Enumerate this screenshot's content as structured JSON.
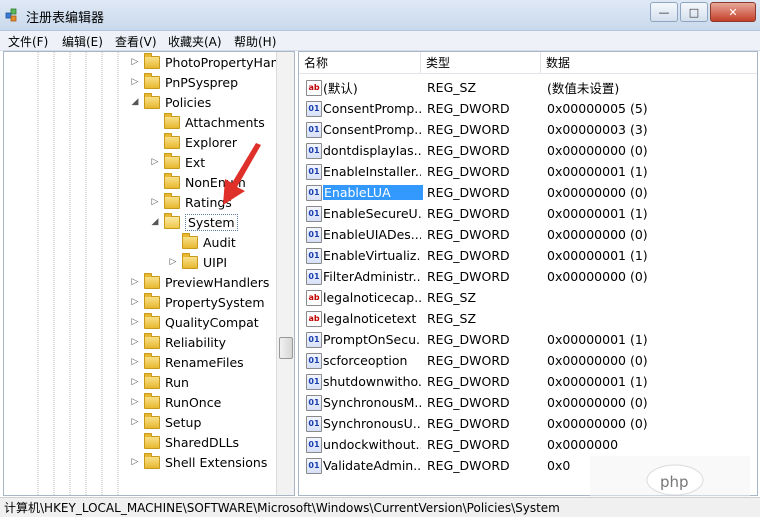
{
  "window": {
    "title": "注册表编辑器",
    "min": "—",
    "max": "□",
    "close": "✕"
  },
  "menu": [
    "文件(F)",
    "编辑(E)",
    "查看(V)",
    "收藏夹(A)",
    "帮助(H)"
  ],
  "tree": [
    {
      "label": "PhotoPropertyHand",
      "expander": "▷"
    },
    {
      "label": "PnPSysprep",
      "expander": "▷"
    },
    {
      "label": "Policies",
      "expander": "◢"
    },
    {
      "label": "Attachments",
      "expander": ""
    },
    {
      "label": "Explorer",
      "expander": ""
    },
    {
      "label": "Ext",
      "expander": "▷"
    },
    {
      "label": "NonEnum",
      "expander": ""
    },
    {
      "label": "Ratings",
      "expander": "▷"
    },
    {
      "label": "System",
      "expander": "◢"
    },
    {
      "label": "Audit",
      "expander": ""
    },
    {
      "label": "UIPI",
      "expander": "▷"
    },
    {
      "label": "PreviewHandlers",
      "expander": "▷"
    },
    {
      "label": "PropertySystem",
      "expander": "▷"
    },
    {
      "label": "QualityCompat",
      "expander": "▷"
    },
    {
      "label": "Reliability",
      "expander": "▷"
    },
    {
      "label": "RenameFiles",
      "expander": "▷"
    },
    {
      "label": "Run",
      "expander": "▷"
    },
    {
      "label": "RunOnce",
      "expander": "▷"
    },
    {
      "label": "Setup",
      "expander": "▷"
    },
    {
      "label": "SharedDLLs",
      "expander": ""
    },
    {
      "label": "Shell Extensions",
      "expander": "▷"
    }
  ],
  "columns": {
    "name": "名称",
    "type": "类型",
    "data": "数据"
  },
  "values": [
    {
      "icon": "ab",
      "name": "(默认)",
      "type": "REG_SZ",
      "data": "(数值未设置)"
    },
    {
      "icon": "01",
      "name": "ConsentPromp...",
      "type": "REG_DWORD",
      "data": "0x00000005 (5)"
    },
    {
      "icon": "01",
      "name": "ConsentPromp...",
      "type": "REG_DWORD",
      "data": "0x00000003 (3)"
    },
    {
      "icon": "01",
      "name": "dontdisplayIas...",
      "type": "REG_DWORD",
      "data": "0x00000000 (0)"
    },
    {
      "icon": "01",
      "name": "EnableInstaller...",
      "type": "REG_DWORD",
      "data": "0x00000001 (1)"
    },
    {
      "icon": "01",
      "name": "EnableLUA",
      "type": "REG_DWORD",
      "data": "0x00000000 (0)"
    },
    {
      "icon": "01",
      "name": "EnableSecureU...",
      "type": "REG_DWORD",
      "data": "0x00000001 (1)"
    },
    {
      "icon": "01",
      "name": "EnableUIADes...",
      "type": "REG_DWORD",
      "data": "0x00000000 (0)"
    },
    {
      "icon": "01",
      "name": "EnableVirtualiz...",
      "type": "REG_DWORD",
      "data": "0x00000001 (1)"
    },
    {
      "icon": "01",
      "name": "FilterAdministr...",
      "type": "REG_DWORD",
      "data": "0x00000000 (0)"
    },
    {
      "icon": "ab",
      "name": "legalnoticecap...",
      "type": "REG_SZ",
      "data": ""
    },
    {
      "icon": "ab",
      "name": "legalnoticetext",
      "type": "REG_SZ",
      "data": ""
    },
    {
      "icon": "01",
      "name": "PromptOnSecu...",
      "type": "REG_DWORD",
      "data": "0x00000001 (1)"
    },
    {
      "icon": "01",
      "name": "scforceoption",
      "type": "REG_DWORD",
      "data": "0x00000000 (0)"
    },
    {
      "icon": "01",
      "name": "shutdownwitho...",
      "type": "REG_DWORD",
      "data": "0x00000001 (1)"
    },
    {
      "icon": "01",
      "name": "SynchronousM...",
      "type": "REG_DWORD",
      "data": "0x00000000 (0)"
    },
    {
      "icon": "01",
      "name": "SynchronousU...",
      "type": "REG_DWORD",
      "data": "0x00000000 (0)"
    },
    {
      "icon": "01",
      "name": "undockwithout...",
      "type": "REG_DWORD",
      "data": "0x0000000"
    },
    {
      "icon": "01",
      "name": "ValidateAdmin...",
      "type": "REG_DWORD",
      "data": "0x0"
    }
  ],
  "selected_value": "EnableLUA",
  "selected_key": "System",
  "status": "计算机\\HKEY_LOCAL_MACHINE\\SOFTWARE\\Microsoft\\Windows\\CurrentVersion\\Policies\\System",
  "watermark": "php",
  "colors": {
    "selection": "#3399ff",
    "arrow": "#e0302a"
  }
}
